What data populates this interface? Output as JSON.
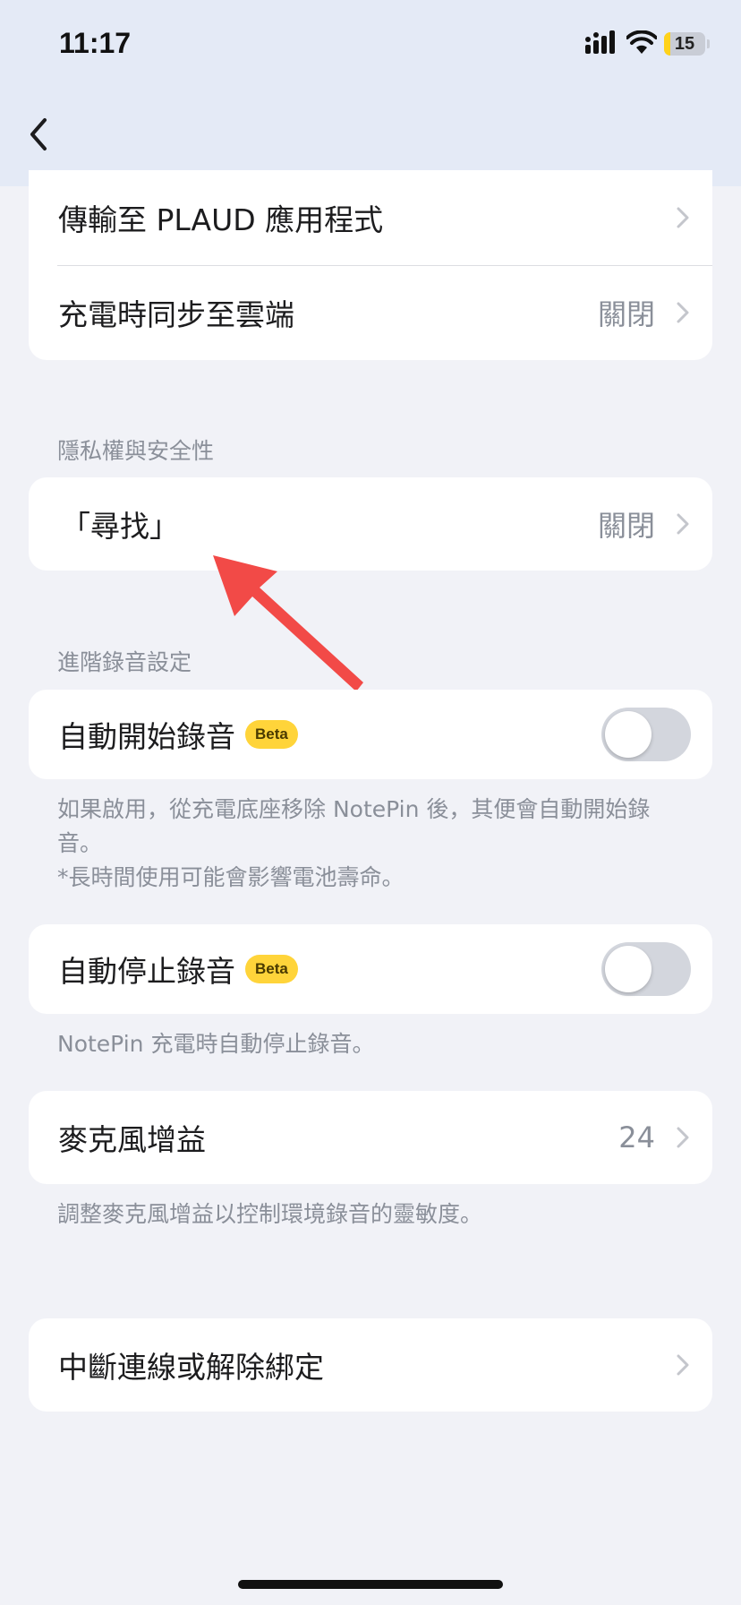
{
  "status_bar": {
    "time": "11:17",
    "battery_level": "15",
    "battery_fraction": 0.15,
    "icons": [
      "signal-icon",
      "wifi-icon",
      "battery-icon"
    ]
  },
  "nav": {
    "back_icon": "chevron-left-icon"
  },
  "sync_card": {
    "transfer_label": "傳輸至 PLAUD 應用程式",
    "cloud_sync_label": "充電時同步至雲端",
    "cloud_sync_value": "關閉"
  },
  "privacy_section": {
    "title": "隱私權與安全性",
    "find_label": "「尋找」",
    "find_value": "關閉"
  },
  "advanced_section": {
    "title": "進階錄音設定",
    "auto_start": {
      "label": "自動開始錄音",
      "badge": "Beta",
      "enabled": false,
      "note_line1": "如果啟用，從充電底座移除 NotePin 後，其便會自動開始錄音。",
      "note_line2": "*長時間使用可能會影響電池壽命。"
    },
    "auto_stop": {
      "label": "自動停止錄音",
      "badge": "Beta",
      "enabled": false,
      "note": "NotePin 充電時自動停止錄音。"
    },
    "mic_gain": {
      "label": "麥克風增益",
      "value": "24",
      "note": "調整麥克風增益以控制環境錄音的靈敏度。"
    }
  },
  "disconnect": {
    "label": "中斷連線或解除綁定"
  },
  "colors": {
    "header_bg": "#e4eaf6",
    "page_bg": "#f1f2f7",
    "badge_bg": "#ffd43a",
    "annotation_arrow": "#f24a47",
    "battery_fill": "#ffd21a"
  }
}
